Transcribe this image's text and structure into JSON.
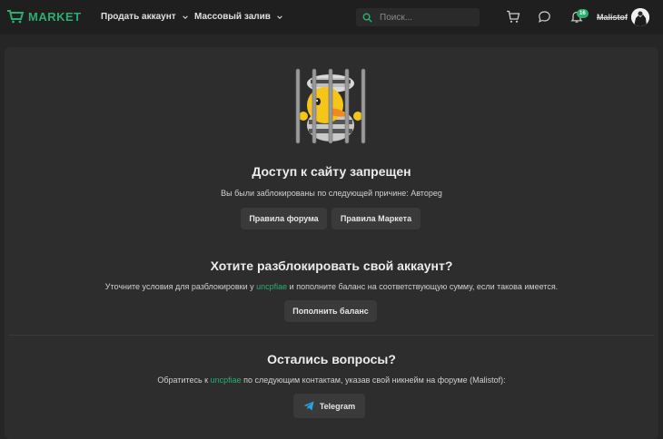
{
  "header": {
    "logo": "MARKET",
    "nav": [
      "Продать аккаунт",
      "Массовый залив"
    ],
    "search_placeholder": "Поиск...",
    "notifications_count": "16",
    "username": "Malistof"
  },
  "banned": {
    "title": "Доступ к сайту запрещен",
    "reason_text": "Вы были заблокированы по следующей причине: Автореg",
    "btn_forum_rules": "Правила форума",
    "btn_market_rules": "Правила Маркета"
  },
  "unban": {
    "title": "Хотите разблокировать свой аккаунт?",
    "text_before": "Уточните условия для разблокировки у ",
    "contact_name": "uncpfiae",
    "text_after": " и пополните баланс на соответствующую сумму, если такова имеется.",
    "btn_topup": "Пополнить баланс"
  },
  "questions": {
    "title": "Остались вопросы?",
    "text_before": "Обратитесь к ",
    "contact_name": "uncpfiae",
    "text_after": " по следующим контактам, указав свой никнейм на форуме (Malistof):",
    "btn_telegram": "Telegram"
  },
  "colors": {
    "accent": "#2bad72",
    "background": "#262626",
    "panel": "#2d2d2d",
    "button": "#3a3a3a",
    "telegram": "#2aa3e0"
  },
  "icons": [
    "cart-icon",
    "market-cart-logo-icon",
    "search-icon",
    "chat-icon",
    "bell-icon",
    "chevron-down-icon",
    "telegram-icon",
    "banned-duck-illustration"
  ]
}
